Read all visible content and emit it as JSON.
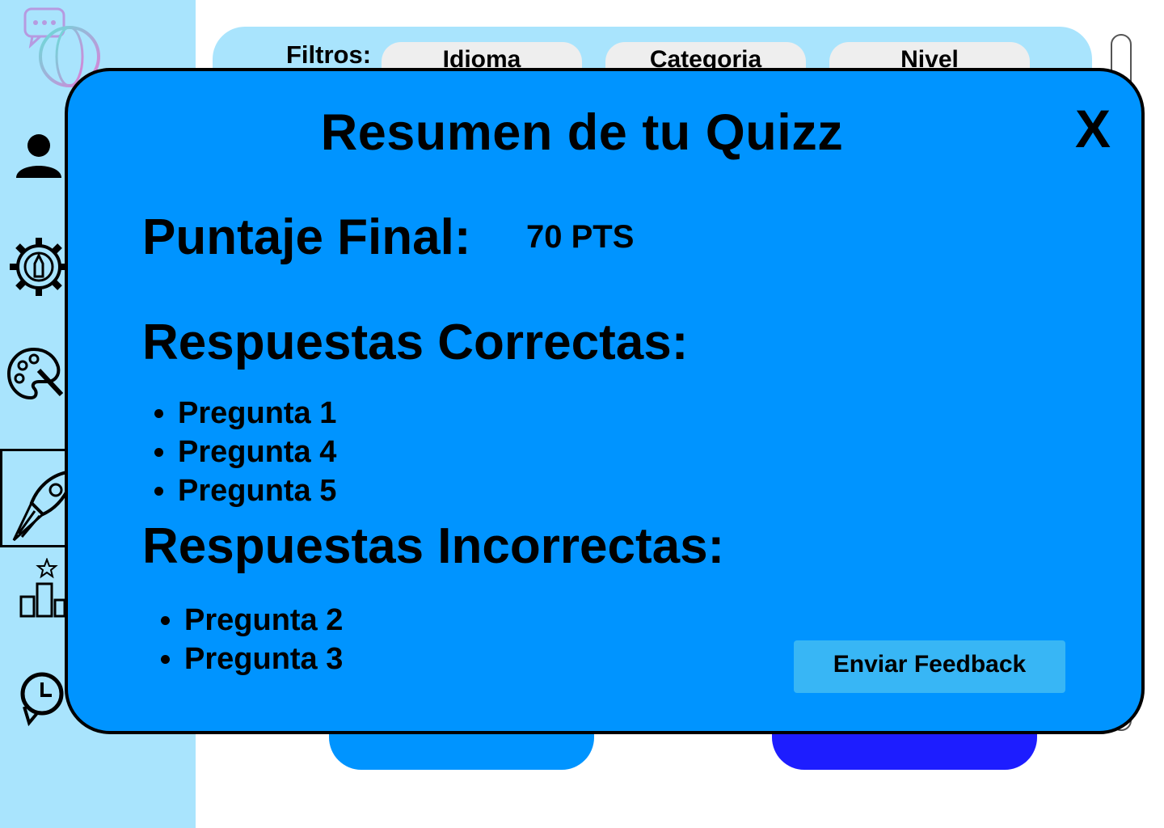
{
  "filters": {
    "label": "Filtros:",
    "chips": [
      "Idioma",
      "Categoria",
      "Nivel"
    ]
  },
  "sidebar": {
    "icons": [
      "chat-globe-icon",
      "user-icon",
      "gear-pencil-icon",
      "palette-icon",
      "rocket-icon",
      "ranking-icon",
      "history-icon"
    ],
    "active_item": "rocket-icon"
  },
  "modal": {
    "title": "Resumen de tu Quizz",
    "close_label": "X",
    "score_label": "Puntaje Final:",
    "score_value": "70 PTS",
    "correct_heading": "Respuestas Correctas:",
    "correct_items": [
      "Pregunta 1",
      "Pregunta 4",
      "Pregunta 5"
    ],
    "incorrect_heading": "Respuestas Incorrectas:",
    "incorrect_items": [
      "Pregunta 2",
      "Pregunta 3"
    ],
    "feedback_button": "Enviar Feedback"
  },
  "colors": {
    "sidebar_bg": "#a9e4fd",
    "modal_bg": "#0094ff",
    "feedback_button_bg": "#38b6f5",
    "background_button_left": "#0094ff",
    "background_button_right": "#1d1dff"
  }
}
